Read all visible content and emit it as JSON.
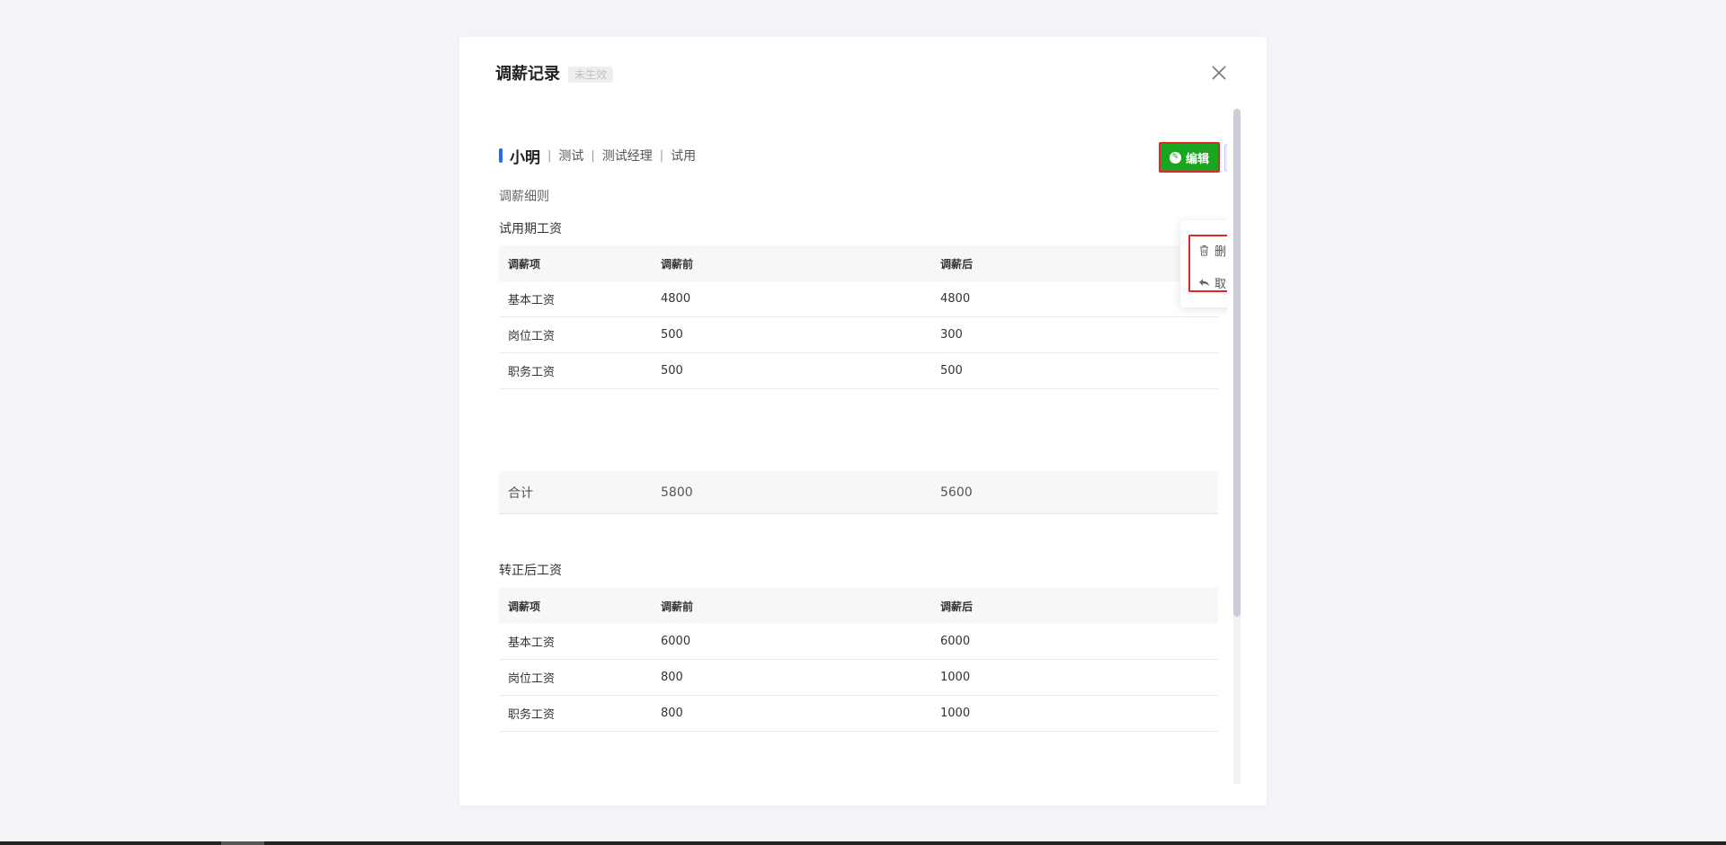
{
  "modal": {
    "title": "调薪记录",
    "status": "未生效"
  },
  "employee": {
    "name": "小明",
    "separator": "|",
    "department": "测试",
    "position": "测试经理",
    "employment_status": "试用"
  },
  "actions": {
    "edit_label": "编辑",
    "more_label": "···",
    "menu": {
      "delete_label": "删除",
      "cancel_label": "取消"
    }
  },
  "detail_label": "调薪细则",
  "probation": {
    "title": "试用期工资",
    "headers": [
      "调薪项",
      "调薪前",
      "调薪后"
    ],
    "rows": [
      [
        "基本工资",
        "4800",
        "4800"
      ],
      [
        "岗位工资",
        "500",
        "300"
      ],
      [
        "职务工资",
        "500",
        "500"
      ]
    ],
    "total": [
      "合计",
      "5800",
      "5600"
    ]
  },
  "regular": {
    "title": "转正后工资",
    "headers": [
      "调薪项",
      "调薪前",
      "调薪后"
    ],
    "rows": [
      [
        "基本工资",
        "6000",
        "6000"
      ],
      [
        "岗位工资",
        "800",
        "1000"
      ],
      [
        "职务工资",
        "800",
        "1000"
      ]
    ]
  },
  "colors": {
    "accent": "#2b66f6",
    "edit_button": "#1aa520",
    "highlight_border": "#e0272b"
  }
}
